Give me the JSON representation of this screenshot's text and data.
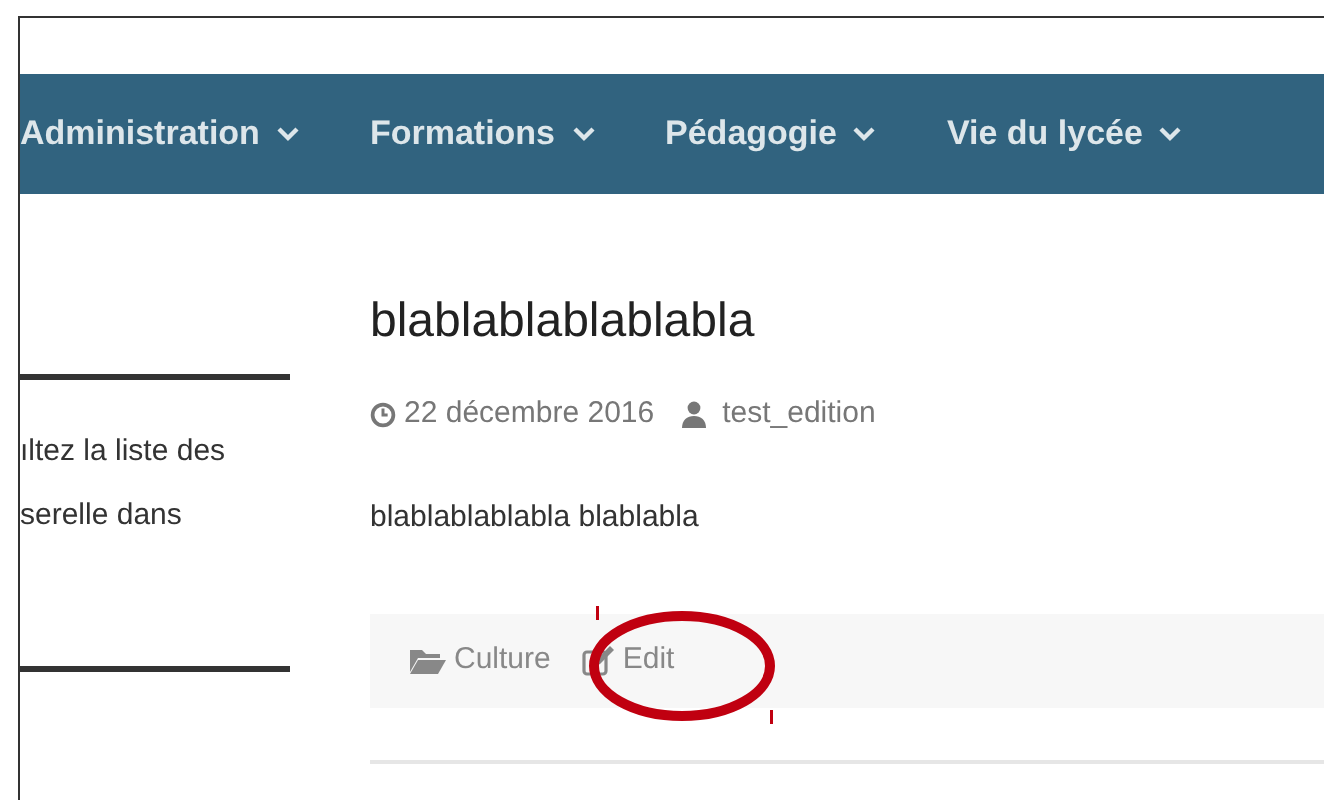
{
  "navbar": {
    "items": [
      {
        "label": "Administration"
      },
      {
        "label": "Formations"
      },
      {
        "label": "Pédagogie"
      },
      {
        "label": "Vie du lycée"
      }
    ]
  },
  "sidebar": {
    "lines": [
      "ıltez la liste des",
      "serelle dans"
    ]
  },
  "article": {
    "title": "blablablablablabla",
    "date": "22 décembre 2016",
    "author": "test_edition",
    "body": "blablablablabla blablabla",
    "category": "Culture",
    "edit_label": "Edit"
  },
  "annotation": {
    "kind": "ellipse",
    "color": "#c00010"
  }
}
